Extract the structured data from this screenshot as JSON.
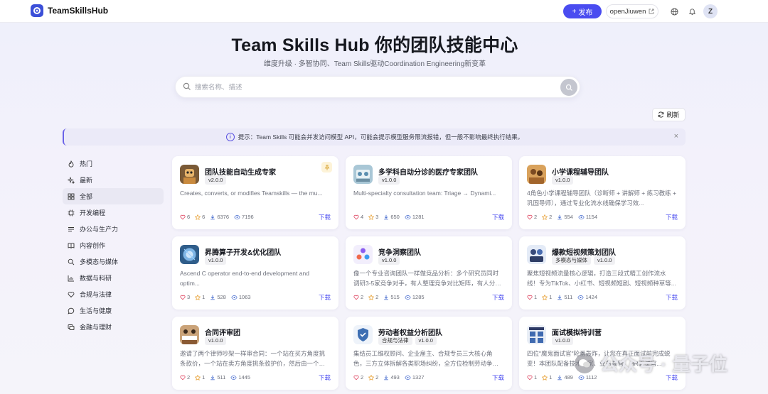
{
  "header": {
    "brand": "TeamSkillsHub",
    "publish_label": "发布",
    "username": "openJiuwen",
    "avatar_letter": "Z",
    "accent": "#4a4cf0"
  },
  "hero": {
    "title": "Team Skills Hub 你的团队技能中心",
    "subtitle": "维度升级 · 多智协同、Team Skills驱动Coordination Engineering新变革"
  },
  "search": {
    "placeholder": "搜索名称、描述"
  },
  "toolbar": {
    "refresh_label": "刷新"
  },
  "notice": {
    "text": "提示：Team Skills 可能会并发访问模型 API，可能会提示模型服务限流报错，但一般不影响最终执行结果。",
    "close": "×"
  },
  "sidebar": {
    "items": [
      {
        "label": "热门",
        "icon": "flame-icon"
      },
      {
        "label": "最新",
        "icon": "sparkle-icon"
      },
      {
        "label": "全部",
        "icon": "grid-icon",
        "active": true
      },
      {
        "label": "开发编程",
        "icon": "chip-icon"
      },
      {
        "label": "办公与生产力",
        "icon": "lines-icon"
      },
      {
        "label": "内容创作",
        "icon": "book-icon"
      },
      {
        "label": "多模态与媒体",
        "icon": "search-icon"
      },
      {
        "label": "数据与科研",
        "icon": "bar-chart-icon"
      },
      {
        "label": "合规与法律",
        "icon": "heart-icon"
      },
      {
        "label": "生活与健康",
        "icon": "chat-icon"
      },
      {
        "label": "金融与理财",
        "icon": "finance-icon"
      }
    ]
  },
  "download_label": "下载",
  "cards": [
    {
      "title": "团队技能自动生成专家",
      "tags": [
        "v2.0.0"
      ],
      "desc": "Creates, converts, or modifies Teamskills — the mu...",
      "likes": "6",
      "stars": "6",
      "downloads": "6376",
      "views": "7196",
      "pinned": true,
      "thumb": "robot"
    },
    {
      "title": "多学科自动分诊的医疗专家团队",
      "tags": [
        "v1.0.0"
      ],
      "desc": "Multi-specialty consultation team: Triage → Dynami...",
      "likes": "4",
      "stars": "3",
      "downloads": "650",
      "views": "1281",
      "thumb": "medical"
    },
    {
      "title": "小学课程辅导团队",
      "tags": [
        "v1.0.0"
      ],
      "desc": "4角色小学课程辅导团队（诊断师 + 讲解师 + 练习教练 + 巩固导师），通过专业化流水线确保学习效...",
      "likes": "2",
      "stars": "2",
      "downloads": "554",
      "views": "1154",
      "thumb": "class"
    },
    {
      "title": "昇腾算子开发&优化团队",
      "tags": [
        "v1.0.0"
      ],
      "desc": "Ascend C operator end-to-end development and optim...",
      "likes": "3",
      "stars": "1",
      "downloads": "528",
      "views": "1063",
      "thumb": "ascend"
    },
    {
      "title": "竞争洞察团队",
      "tags": [
        "v1.0.0"
      ],
      "desc": "像一个专业咨询团队一样做竞品分析：多个研究员同时调研3-5家竞争对手，有人整理竞争对比矩阵，有人分析...",
      "likes": "2",
      "stars": "2",
      "downloads": "515",
      "views": "1285",
      "thumb": "insight"
    },
    {
      "title": "爆款短视频策划团队",
      "tags": [
        "多模态与媒体",
        "v1.0.0"
      ],
      "desc": "聚焦短视频流量核心逻辑，打造三段式精工创作流水线！专为TikTok、小红书、短视频短剧、短视频种草等...",
      "likes": "1",
      "stars": "1",
      "downloads": "511",
      "views": "1424",
      "thumb": "video"
    },
    {
      "title": "合同评审团",
      "tags": [
        "v1.0.0"
      ],
      "desc": "邀请了两个律师吵架一样审合同：一个站在买方角度挑条款价，一个站在卖方角度挑条款护价，然后由一个中立仲裁...",
      "likes": "2",
      "stars": "1",
      "downloads": "511",
      "views": "1445",
      "thumb": "meeting"
    },
    {
      "title": "劳动者权益分析团队",
      "tags": [
        "合规与法律",
        "v1.0.0"
      ],
      "desc": "集结员工维权顾问、企业雇主、合规专员三大核心角色，三方立体拆解各类职场纠纷，全方位检制劳动争议现实走...",
      "likes": "2",
      "stars": "2",
      "downloads": "493",
      "views": "1327",
      "thumb": "shield"
    },
    {
      "title": "面试模拟特训营",
      "tags": [
        "v1.0.0"
      ],
      "desc": "四位\"魔鬼面试官\"轮番轰炸，让您在真正面试前完成蜕变！本团队配备技术专家、业务高管、HR面试官...",
      "likes": "1",
      "stars": "1",
      "downloads": "489",
      "views": "1112",
      "thumb": "interview"
    }
  ],
  "watermark": {
    "text": "公众号 · 量子位"
  }
}
